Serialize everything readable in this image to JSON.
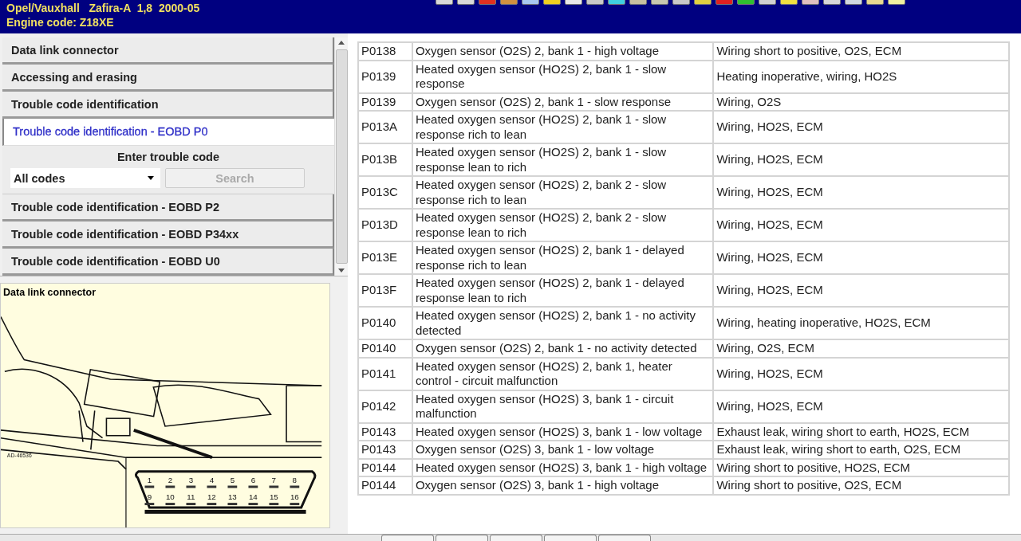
{
  "header": {
    "vehicle": "Opel/Vauxhall   Zafira-A  1,8  2000-05",
    "engine": "Engine code: Z18XE"
  },
  "nav": {
    "items": [
      {
        "label": "Data link connector",
        "selected": false
      },
      {
        "label": "Accessing and erasing",
        "selected": false
      },
      {
        "label": "Trouble code identification",
        "selected": false
      },
      {
        "label": "Trouble code identification - EOBD P0",
        "selected": true
      },
      {
        "label": "Trouble code identification - EOBD P2",
        "selected": false
      },
      {
        "label": "Trouble code identification - EOBD P34xx",
        "selected": false
      },
      {
        "label": "Trouble code identification - EOBD U0",
        "selected": false
      }
    ],
    "search": {
      "title": "Enter trouble code",
      "filter": "All codes",
      "button": "Search",
      "button_disabled": true
    }
  },
  "figure": {
    "title": "Data link connector",
    "ref": "AD-46536",
    "pins": [
      "1",
      "2",
      "3",
      "4",
      "5",
      "6",
      "7",
      "8",
      "9",
      "10",
      "11",
      "12",
      "13",
      "14",
      "15",
      "16"
    ]
  },
  "table": {
    "rows": [
      {
        "code": "P0138",
        "description": "Oxygen sensor (O2S) 2, bank 1 - high voltage",
        "cause": "Wiring short to positive, O2S, ECM"
      },
      {
        "code": "P0139",
        "description": "Heated oxygen sensor (HO2S) 2, bank 1 - slow response",
        "cause": "Heating inoperative, wiring, HO2S"
      },
      {
        "code": "P0139",
        "description": "Oxygen sensor (O2S) 2, bank 1 - slow response",
        "cause": "Wiring, O2S"
      },
      {
        "code": "P013A",
        "description": "Heated oxygen sensor (HO2S) 2, bank 1 - slow response rich to lean",
        "cause": "Wiring, HO2S, ECM"
      },
      {
        "code": "P013B",
        "description": "Heated oxygen sensor (HO2S) 2, bank 1 - slow response lean to rich",
        "cause": "Wiring, HO2S, ECM"
      },
      {
        "code": "P013C",
        "description": "Heated oxygen sensor (HO2S) 2, bank 2 - slow response rich to lean",
        "cause": "Wiring, HO2S, ECM"
      },
      {
        "code": "P013D",
        "description": "Heated oxygen sensor (HO2S) 2, bank 2 - slow response lean to rich",
        "cause": "Wiring, HO2S, ECM"
      },
      {
        "code": "P013E",
        "description": "Heated oxygen sensor (HO2S) 2, bank 1 - delayed response rich to lean",
        "cause": "Wiring, HO2S, ECM"
      },
      {
        "code": "P013F",
        "description": "Heated oxygen sensor (HO2S) 2, bank 1 - delayed response lean to rich",
        "cause": "Wiring, HO2S, ECM"
      },
      {
        "code": "P0140",
        "description": "Heated oxygen sensor (HO2S) 2, bank 1 - no activity detected",
        "cause": "Wiring, heating inoperative, HO2S, ECM"
      },
      {
        "code": "P0140",
        "description": "Oxygen sensor (O2S) 2, bank 1 - no activity detected",
        "cause": "Wiring, O2S, ECM"
      },
      {
        "code": "P0141",
        "description": "Heated oxygen sensor (HO2S) 2, bank 1, heater control - circuit malfunction",
        "cause": "Wiring, HO2S, ECM"
      },
      {
        "code": "P0142",
        "description": "Heated oxygen sensor (HO2S) 3, bank 1 - circuit malfunction",
        "cause": "Wiring, HO2S, ECM"
      },
      {
        "code": "P0143",
        "description": "Heated oxygen sensor (HO2S) 3, bank 1 - low voltage",
        "cause": "Exhaust leak, wiring short to earth, HO2S, ECM"
      },
      {
        "code": "P0143",
        "description": "Oxygen sensor (O2S) 3, bank 1 - low voltage",
        "cause": "Exhaust leak, wiring short to earth, O2S, ECM"
      },
      {
        "code": "P0144",
        "description": "Heated oxygen sensor (HO2S) 3, bank 1 - high voltage",
        "cause": "Wiring short to positive, HO2S, ECM"
      },
      {
        "code": "P0144",
        "description": "Oxygen sensor (O2S) 3, bank 1 - high voltage",
        "cause": "Wiring short to positive, O2S, ECM"
      }
    ]
  }
}
